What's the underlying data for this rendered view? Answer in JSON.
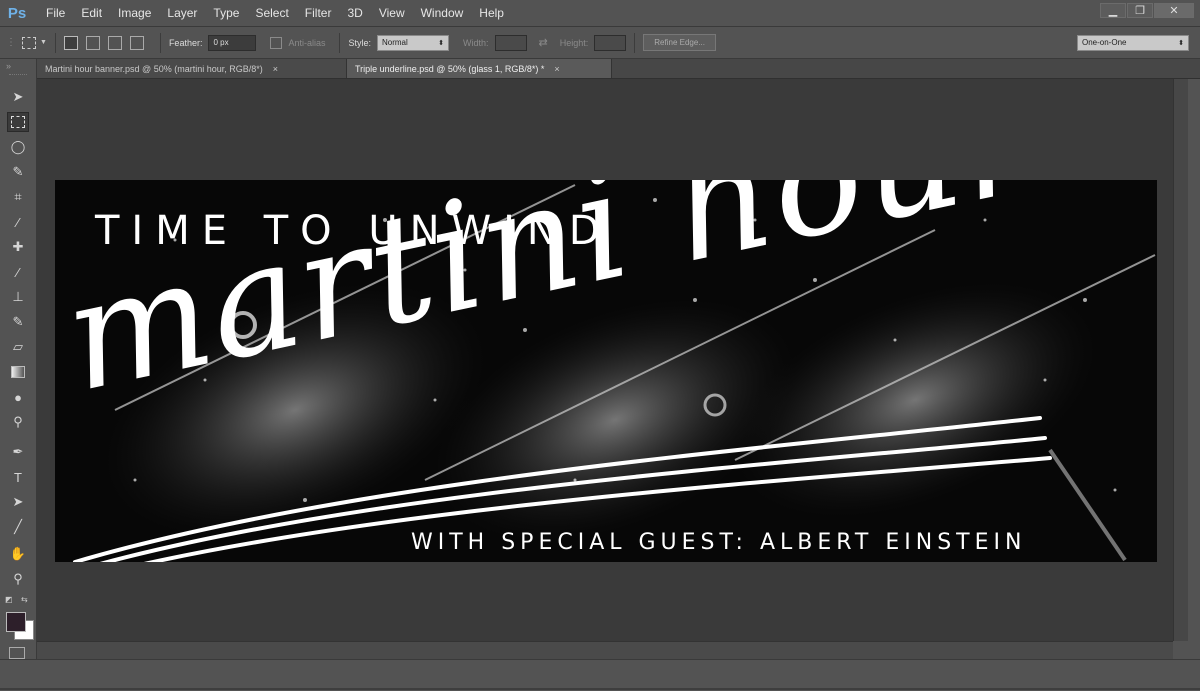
{
  "app": {
    "logo": "Ps"
  },
  "menu": [
    "File",
    "Edit",
    "Image",
    "Layer",
    "Type",
    "Select",
    "Filter",
    "3D",
    "View",
    "Window",
    "Help"
  ],
  "window_controls": {
    "minimize": "▁",
    "restore": "❐",
    "close": "✕"
  },
  "options": {
    "feather_label": "Feather:",
    "feather_value": "0 px",
    "antialias_label": "Anti-alias",
    "style_label": "Style:",
    "style_value": "Normal",
    "width_label": "Width:",
    "height_label": "Height:",
    "refine_edge": "Refine Edge...",
    "view_mode": "One-on-One"
  },
  "tabs": [
    {
      "label": "Martini hour banner.psd @ 50% (martini hour, RGB/8*)",
      "close": "×"
    },
    {
      "label": "Triple underline.psd @ 50% (glass 1, RGB/8*) *",
      "close": "×"
    }
  ],
  "banner": {
    "tagline": "TIME TO UNWIND",
    "script_title": "martini hour",
    "subline": "WITH SPECIAL GUEST: ALBERT EINSTEIN"
  },
  "colors": {
    "panel": "#535353",
    "workspace": "#3a3a3a",
    "canvas_bg": "#070707",
    "foreground_swatch": "#2d1f2a",
    "background_swatch": "#ffffff",
    "ps_blue": "#6fb2e8"
  },
  "tools": [
    "move-tool-icon",
    "rectangular-marquee-icon",
    "lasso-icon",
    "quick-selection-icon",
    "crop-icon",
    "eyedropper-icon",
    "spot-healing-icon",
    "brush-icon",
    "clone-stamp-icon",
    "history-brush-icon",
    "eraser-icon",
    "gradient-icon",
    "blur-icon",
    "dodge-icon",
    "pen-icon",
    "type-icon",
    "path-selection-icon",
    "line-icon",
    "hand-icon",
    "zoom-icon"
  ]
}
